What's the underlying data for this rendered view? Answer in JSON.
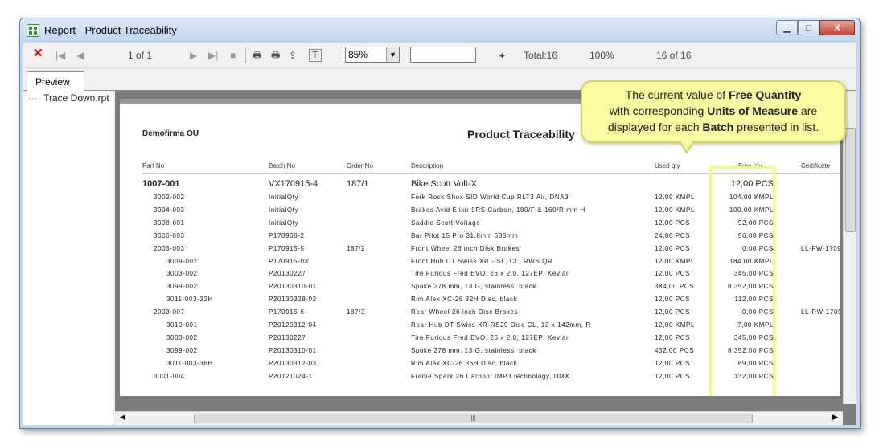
{
  "window": {
    "title": "Report - Product Traceability",
    "minimize_label": "▁",
    "maximize_label": "□",
    "close_label": "X"
  },
  "toolbar": {
    "close_icon": "✕",
    "page_indicator": "1 of 1",
    "zoom_value": "85%",
    "search_value": "",
    "total_label": "Total:16",
    "percent_label": "100%",
    "records_label": "16 of 16"
  },
  "tabs": {
    "preview": "Preview"
  },
  "tree": {
    "item": "Trace Down.rpt"
  },
  "report": {
    "company": "Demofirma OÜ",
    "title": "Product Traceability",
    "columns": [
      "Part No",
      "Batch No",
      "Order No",
      "Description",
      "Used qty",
      "Free qty",
      "Certificate"
    ],
    "main_row": {
      "part": "1007-001",
      "batch": "VX170915-4",
      "order": "187/1",
      "description": "Bike Scott Volt-X",
      "used": "",
      "free": "12,00 PCS",
      "cert": ""
    },
    "rows": [
      {
        "part": "3002-002",
        "indent": 1,
        "batch": "InitialQty",
        "order": "",
        "description": "Fork Rock Shox SID World Cup RLT3 Air, DNA3",
        "used": "12,00 KMPL",
        "free": "104,00 KMPL",
        "cert": ""
      },
      {
        "part": "3004-003",
        "indent": 1,
        "batch": "InitialQty",
        "order": "",
        "description": "Brakes Avid Elixir 9RS Carbon, 180/F & 160/R mm H",
        "used": "12,00 KMPL",
        "free": "100,00 KMPL",
        "cert": ""
      },
      {
        "part": "3008-001",
        "indent": 1,
        "batch": "InitialQty",
        "order": "",
        "description": "Saddle Scott Voltage",
        "used": "12,00 PCS",
        "free": "92,00 PCS",
        "cert": ""
      },
      {
        "part": "3006-003",
        "indent": 1,
        "batch": "P170908-2",
        "order": "",
        "description": "Bar Pilot 15 Pro 31.8mm 680mm",
        "used": "24,00 PCS",
        "free": "56,00 PCS",
        "cert": ""
      },
      {
        "part": "2003-003",
        "indent": 1,
        "batch": "P170915-5",
        "order": "187/2",
        "description": "Front Wheel 26 inch Disk Brakes",
        "used": "12,00 PCS",
        "free": "0,00 PCS",
        "cert": "LL-FW-1709"
      },
      {
        "part": "3009-002",
        "indent": 2,
        "batch": "P170915-03",
        "order": "",
        "description": "Front Hub DT Swiss XR - SL, CL, RWS QR",
        "used": "12,00 KMPL",
        "free": "184,00 KMPL",
        "cert": ""
      },
      {
        "part": "3003-002",
        "indent": 2,
        "batch": "P20130227",
        "order": "",
        "description": "Tire Furious Fred EVO, 26 x 2.0, 127EPI Kevlar",
        "used": "12,00 PCS",
        "free": "345,00 PCS",
        "cert": ""
      },
      {
        "part": "3099-002",
        "indent": 2,
        "batch": "P20130310-01",
        "order": "",
        "description": "Spoke 278 mm, 13 G, stainless, black",
        "used": "384,00 PCS",
        "free": "8 352,00 PCS",
        "cert": ""
      },
      {
        "part": "3011-003-32H",
        "indent": 2,
        "batch": "P20130328-02",
        "order": "",
        "description": "Rim Alex XC-26 32H Disc, black",
        "used": "12,00 PCS",
        "free": "112,00 PCS",
        "cert": ""
      },
      {
        "part": "2003-007",
        "indent": 1,
        "batch": "P170915-6",
        "order": "187/3",
        "description": "Rear Wheel 26 inch Disc Brakes",
        "used": "12,00 PCS",
        "free": "0,00 PCS",
        "cert": "LL-RW-1709"
      },
      {
        "part": "3010-001",
        "indent": 2,
        "batch": "P20120312-04",
        "order": "",
        "description": "Rear Hub DT Swiss XR-RS29 Disc CL, 12 x 142mm, R",
        "used": "12,00 KMPL",
        "free": "7,00 KMPL",
        "cert": ""
      },
      {
        "part": "3003-002",
        "indent": 2,
        "batch": "P20130227",
        "order": "",
        "description": "Tire Furious Fred EVO, 26 x 2.0, 127EPI Kevlar",
        "used": "12,00 PCS",
        "free": "345,00 PCS",
        "cert": ""
      },
      {
        "part": "3099-002",
        "indent": 2,
        "batch": "P20130310-01",
        "order": "",
        "description": "Spoke 278 mm, 13 G, stainless, black",
        "used": "432,00 PCS",
        "free": "8 352,00 PCS",
        "cert": ""
      },
      {
        "part": "3011-003-36H",
        "indent": 2,
        "batch": "P20130312-03",
        "order": "",
        "description": "Rim Alex XC-26 36H Disc, black",
        "used": "12,00 PCS",
        "free": "69,00 PCS",
        "cert": ""
      },
      {
        "part": "3001-004",
        "indent": 1,
        "batch": "P20121024-1",
        "order": "",
        "description": "Frame Spark 26 Carbon, IMP3 technology, DMX",
        "used": "12,00 PCS",
        "free": "132,00 PCS",
        "cert": ""
      }
    ]
  },
  "callout": {
    "line1_pre": "The current value of ",
    "line1_bold": "Free Quantity",
    "line2_pre": "with corresponding ",
    "line2_bold": "Units of Measure",
    "line2_post": " are",
    "line3_pre": "displayed for each ",
    "line3_bold": "Batch",
    "line3_post": " presented in list."
  },
  "colors": {
    "highlight": "#f3f97a",
    "callout_bg": "#fafba0",
    "close_x": "#c00000"
  },
  "icons": {
    "close": "close-icon",
    "first": "first-page-icon",
    "prev": "prev-page-icon",
    "next": "next-page-icon",
    "last": "last-page-icon",
    "stop": "stop-icon",
    "print": "print-icon",
    "printer-setup": "printer-setup-icon",
    "export": "export-icon",
    "group-tree": "group-tree-icon",
    "search": "binoculars-icon"
  }
}
